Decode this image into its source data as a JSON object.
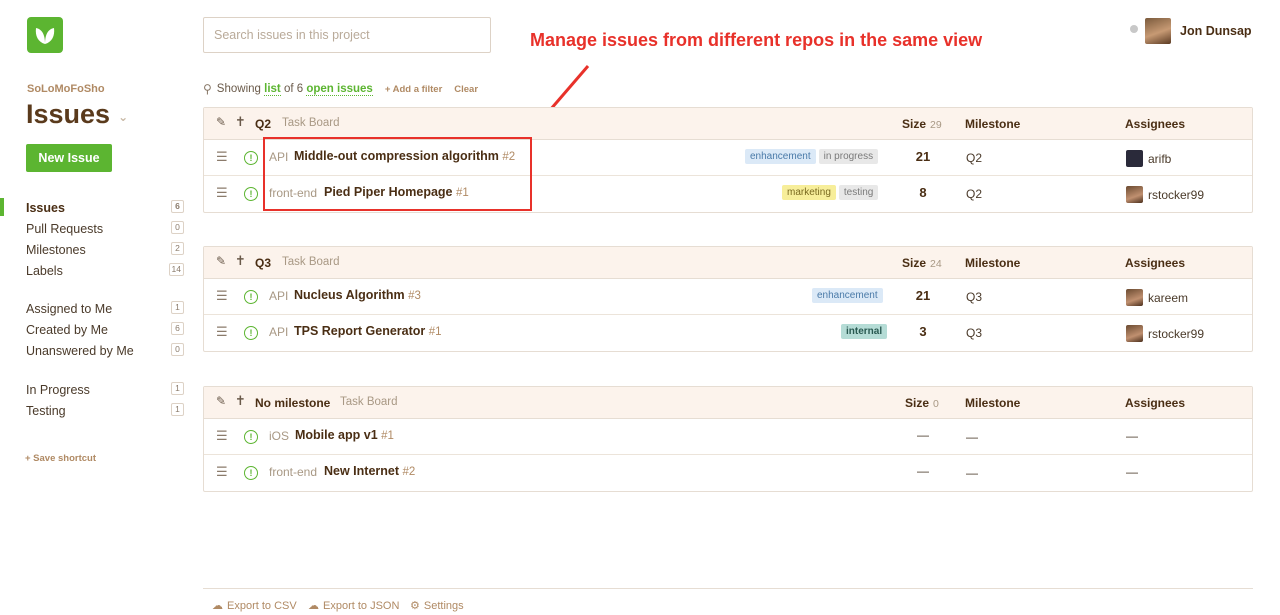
{
  "project_name": "SoLoMoFoSho",
  "page_title": "Issues",
  "new_issue_label": "New Issue",
  "search_placeholder": "Search issues in this project",
  "annotation": "Manage issues from different repos in the same view",
  "user": {
    "name": "Jon Dunsap"
  },
  "nav_main": [
    {
      "label": "Issues",
      "count": "6",
      "active": true
    },
    {
      "label": "Pull Requests",
      "count": "0"
    },
    {
      "label": "Milestones",
      "count": "2"
    },
    {
      "label": "Labels",
      "count": "14"
    }
  ],
  "nav_filters": [
    {
      "label": "Assigned to Me",
      "count": "1"
    },
    {
      "label": "Created by Me",
      "count": "6"
    },
    {
      "label": "Unanswered by Me",
      "count": "0"
    }
  ],
  "nav_labels": [
    {
      "label": "In Progress",
      "count": "1"
    },
    {
      "label": "Testing",
      "count": "1"
    }
  ],
  "save_shortcut": "+ Save shortcut",
  "filter": {
    "showing": "Showing",
    "list": "list",
    "of": "of 6",
    "open_issues": "open issues",
    "add_filter": "+ Add a filter",
    "clear": "Clear"
  },
  "columns": {
    "size": "Size",
    "milestone": "Milestone",
    "assignees": "Assignees"
  },
  "groups": [
    {
      "name": "Q2",
      "board": "Task Board",
      "size_total": "29",
      "issues": [
        {
          "repo": "API",
          "title": "Middle-out compression algorithm",
          "number": "#2",
          "labels": [
            {
              "text": "enhancement",
              "bg": "#dbe9f7",
              "color": "#4a7aa8"
            },
            {
              "text": "in progress",
              "bg": "#e8e8e8",
              "color": "#7a7a7a"
            }
          ],
          "size": "21",
          "milestone": "Q2",
          "assignee": "arifb"
        },
        {
          "repo": "front-end",
          "title": "Pied Piper Homepage",
          "number": "#1",
          "labels": [
            {
              "text": "marketing",
              "bg": "#f7ee9a",
              "color": "#7a6a20"
            },
            {
              "text": "testing",
              "bg": "#e8e8e8",
              "color": "#7a7a7a"
            }
          ],
          "size": "8",
          "milestone": "Q2",
          "assignee": "rstocker99"
        }
      ]
    },
    {
      "name": "Q3",
      "board": "Task Board",
      "size_total": "24",
      "issues": [
        {
          "repo": "API",
          "title": "Nucleus Algorithm",
          "number": "#3",
          "labels": [
            {
              "text": "enhancement",
              "bg": "#dbe9f7",
              "color": "#4a7aa8"
            }
          ],
          "size": "21",
          "milestone": "Q3",
          "assignee": "kareem"
        },
        {
          "repo": "API",
          "title": "TPS Report Generator",
          "number": "#1",
          "labels": [
            {
              "text": "internal",
              "bg": "#b5dcd6",
              "color": "#2a5a52"
            }
          ],
          "size": "3",
          "milestone": "Q3",
          "assignee": "rstocker99"
        }
      ]
    },
    {
      "name": "No milestone",
      "board": "Task Board",
      "size_total": "0",
      "issues": [
        {
          "repo": "iOS",
          "title": "Mobile app v1",
          "number": "#1",
          "labels": [],
          "size": "—",
          "milestone": "—",
          "assignee": "—"
        },
        {
          "repo": "front-end",
          "title": "New Internet",
          "number": "#2",
          "labels": [],
          "size": "—",
          "milestone": "—",
          "assignee": "—"
        }
      ]
    }
  ],
  "footer": {
    "csv": "Export to CSV",
    "json": "Export to JSON",
    "settings": "Settings"
  },
  "colors": {
    "brand": "#5cb531",
    "annotation": "#e8312a",
    "header_bg": "#fcf3ec"
  }
}
